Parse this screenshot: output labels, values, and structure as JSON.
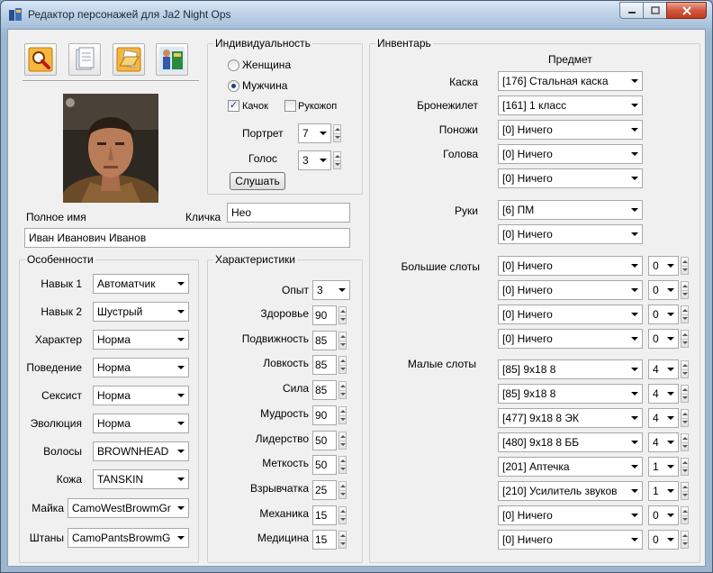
{
  "window": {
    "title": "Редактор персонажей для Ja2 Night Ops"
  },
  "toolbar": {
    "icons": [
      "search-icon",
      "document-icon",
      "folder-open-icon",
      "ja2-logo-icon"
    ]
  },
  "individuality": {
    "title": "Индивидуальность",
    "gender_female": "Женщина",
    "gender_male": "Мужчина",
    "selected_gender": "Мужчина",
    "jock_label": "Качок",
    "jock_checked": true,
    "butterfingers_label": "Рукожоп",
    "butterfingers_checked": false,
    "portrait_label": "Портрет",
    "portrait_value": "7",
    "voice_label": "Голос",
    "voice_value": "3",
    "listen_button": "Слушать"
  },
  "names": {
    "fullname_label": "Полное имя",
    "nickname_label": "Кличка",
    "nickname_value": "Нео",
    "fullname_value": "Иван Иванович Иванов"
  },
  "traits": {
    "title": "Особенности",
    "rows": [
      {
        "label": "Навык 1",
        "value": "Автоматчик"
      },
      {
        "label": "Навык 2",
        "value": "Шустрый"
      },
      {
        "label": "Характер",
        "value": "Норма"
      },
      {
        "label": "Поведение",
        "value": "Норма"
      },
      {
        "label": "Сексист",
        "value": "Норма"
      },
      {
        "label": "Эволюция",
        "value": "Норма"
      },
      {
        "label": "Волосы",
        "value": "BROWNHEAD"
      },
      {
        "label": "Кожа",
        "value": "TANSKIN"
      },
      {
        "label": "Майка",
        "value": "CamoWestBrowmGr"
      },
      {
        "label": "Штаны",
        "value": "CamoPantsBrowmG"
      }
    ]
  },
  "stats": {
    "title": "Характеристики",
    "experience_label": "Опыт",
    "experience_value": "3",
    "rows": [
      {
        "label": "Здоровье",
        "value": "90"
      },
      {
        "label": "Подвижность",
        "value": "85"
      },
      {
        "label": "Ловкость",
        "value": "85"
      },
      {
        "label": "Сила",
        "value": "85"
      },
      {
        "label": "Мудрость",
        "value": "90"
      },
      {
        "label": "Лидерство",
        "value": "50"
      },
      {
        "label": "Меткость",
        "value": "50"
      },
      {
        "label": "Взрывчатка",
        "value": "25"
      },
      {
        "label": "Механика",
        "value": "15"
      },
      {
        "label": "Медицина",
        "value": "15"
      }
    ]
  },
  "inventory": {
    "title": "Инвентарь",
    "column_header": "Предмет",
    "helmet_label": "Каска",
    "helmet": "[176] Стальная каска",
    "vest_label": "Бронежилет",
    "vest": "[161] 1 класс",
    "legs_label": "Поножи",
    "legs": "[0] Ничего",
    "head_label": "Голова",
    "head": [
      "[0] Ничего",
      "[0] Ничего"
    ],
    "hands_label": "Руки",
    "hands": [
      "[6] ПМ",
      "[0] Ничего"
    ],
    "big_slots_label": "Большие слоты",
    "big_slots": [
      {
        "item": "[0] Ничего",
        "count": "0"
      },
      {
        "item": "[0] Ничего",
        "count": "0"
      },
      {
        "item": "[0] Ничего",
        "count": "0"
      },
      {
        "item": "[0] Ничего",
        "count": "0"
      }
    ],
    "small_slots_label": "Малые слоты",
    "small_slots": [
      {
        "item": "[85] 9x18 8",
        "count": "4"
      },
      {
        "item": "[85] 9x18 8",
        "count": "4"
      },
      {
        "item": "[477] 9x18 8 ЭК",
        "count": "4"
      },
      {
        "item": "[480] 9x18 8 ББ",
        "count": "4"
      },
      {
        "item": "[201] Аптечка",
        "count": "1"
      },
      {
        "item": "[210] Усилитель звуков",
        "count": "1"
      },
      {
        "item": "[0] Ничего",
        "count": "0"
      },
      {
        "item": "[0] Ничего",
        "count": "0"
      }
    ]
  }
}
